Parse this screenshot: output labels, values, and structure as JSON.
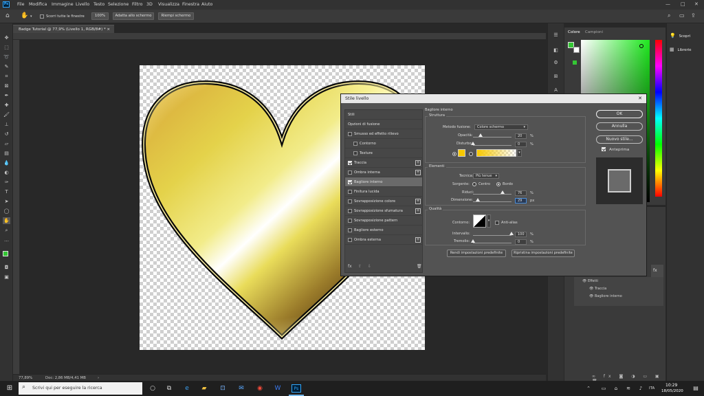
{
  "app": {
    "icon_label": "Ps"
  },
  "menu": [
    "File",
    "Modifica",
    "Immagine",
    "Livello",
    "Testo",
    "Selezione",
    "Filtro",
    "3D",
    "Visualizza",
    "Finestra",
    "Aiuto"
  ],
  "window_controls": {
    "minimize": "—",
    "maximize": "□",
    "close": "✕"
  },
  "options_bar": {
    "scroll_all_label": "Scorri tutte le finestre",
    "zoom_100": "100%",
    "fit_screen": "Adatta allo schermo",
    "fill_screen": "Riempi schermo"
  },
  "document": {
    "tab_title": "Badge Tutorial @ 77,9% (Livello 1, RGB/8#) *",
    "tab_close": "×"
  },
  "status": {
    "zoom": "77,89%",
    "doc_info": "Doc: 2,86 MB/4,41 MB",
    "arrow": "›"
  },
  "color_panel": {
    "tabs": [
      "Colore",
      "Campioni"
    ],
    "accent": "#34c734"
  },
  "learn_panel": {
    "items": [
      "Scopri",
      "Librerie"
    ]
  },
  "layers_panel": {
    "effects_label": "Effetti",
    "effect_items": [
      "Traccia",
      "Bagliore interno"
    ],
    "fx_label": "fx"
  },
  "dialog": {
    "title": "Stile livello",
    "close": "✕",
    "list_header": "Stili",
    "list_items": [
      {
        "label": "Opzioni di fusione",
        "checkbox": false,
        "checked": false,
        "plus": false,
        "indent": false
      },
      {
        "label": "Smusso ed effetto rilievo",
        "checkbox": true,
        "checked": false,
        "plus": false,
        "indent": false
      },
      {
        "label": "Contorno",
        "checkbox": true,
        "checked": false,
        "plus": false,
        "indent": true
      },
      {
        "label": "Texture",
        "checkbox": true,
        "checked": false,
        "plus": false,
        "indent": true
      },
      {
        "label": "Traccia",
        "checkbox": true,
        "checked": true,
        "plus": true,
        "indent": false
      },
      {
        "label": "Ombra interna",
        "checkbox": true,
        "checked": false,
        "plus": true,
        "indent": false
      },
      {
        "label": "Bagliore interno",
        "checkbox": true,
        "checked": true,
        "plus": false,
        "indent": false
      },
      {
        "label": "Finitura lucida",
        "checkbox": true,
        "checked": false,
        "plus": false,
        "indent": false
      },
      {
        "label": "Sovrapposizione colore",
        "checkbox": true,
        "checked": false,
        "plus": true,
        "indent": false
      },
      {
        "label": "Sovrapposizione sfumatura",
        "checkbox": true,
        "checked": false,
        "plus": true,
        "indent": false
      },
      {
        "label": "Sovrapposizione pattern",
        "checkbox": true,
        "checked": false,
        "plus": false,
        "indent": false
      },
      {
        "label": "Bagliore esterno",
        "checkbox": true,
        "checked": false,
        "plus": false,
        "indent": false
      },
      {
        "label": "Ombra esterna",
        "checkbox": true,
        "checked": false,
        "plus": true,
        "indent": false
      }
    ],
    "list_footer": {
      "fx": "fx",
      "up": "⇧",
      "down": "⇩",
      "trash": "🗑"
    },
    "panel": {
      "section_title": "Bagliore interno",
      "structure": {
        "title": "Struttura",
        "blend_mode_label": "Metodo fusione:",
        "blend_mode_value": "Colore schermo",
        "opacity_label": "Opacità:",
        "opacity_value": "20",
        "opacity_unit": "%",
        "opacity_fraction": 0.2,
        "noise_label": "Disturbo:",
        "noise_value": "0",
        "noise_unit": "%",
        "noise_fraction": 0.0,
        "glow_color": "#f7c800"
      },
      "elements": {
        "title": "Elementi",
        "technique_label": "Tecnica:",
        "technique_value": "Più tenue",
        "source_label": "Sorgente:",
        "source_center": "Centro",
        "source_edge": "Bordo",
        "choke_label": "Riduci:",
        "choke_value": "76",
        "choke_unit": "%",
        "choke_fraction": 0.76,
        "size_label": "Dimensione:",
        "size_value": "29",
        "size_unit": "px",
        "size_fraction": 0.12
      },
      "quality": {
        "title": "Qualità",
        "contour_label": "Contorno:",
        "antialias_label": "Anti-alias",
        "range_label": "Intervallo:",
        "range_value": "100",
        "range_unit": "%",
        "range_fraction": 1.0,
        "jitter_label": "Tremolio:",
        "jitter_value": "0",
        "jitter_unit": "%",
        "jitter_fraction": 0.0
      },
      "make_default": "Rendi impostazioni predefinite",
      "reset_default": "Ripristina impostazioni predefinite"
    },
    "buttons": {
      "ok": "OK",
      "cancel": "Annulla",
      "new_style": "Nuovo stile...",
      "preview": "Anteprima"
    }
  },
  "taskbar": {
    "search_placeholder": "Scrivi qui per eseguire la ricerca",
    "time": "10:29",
    "date": "18/05/2020",
    "lang": "ITA"
  }
}
